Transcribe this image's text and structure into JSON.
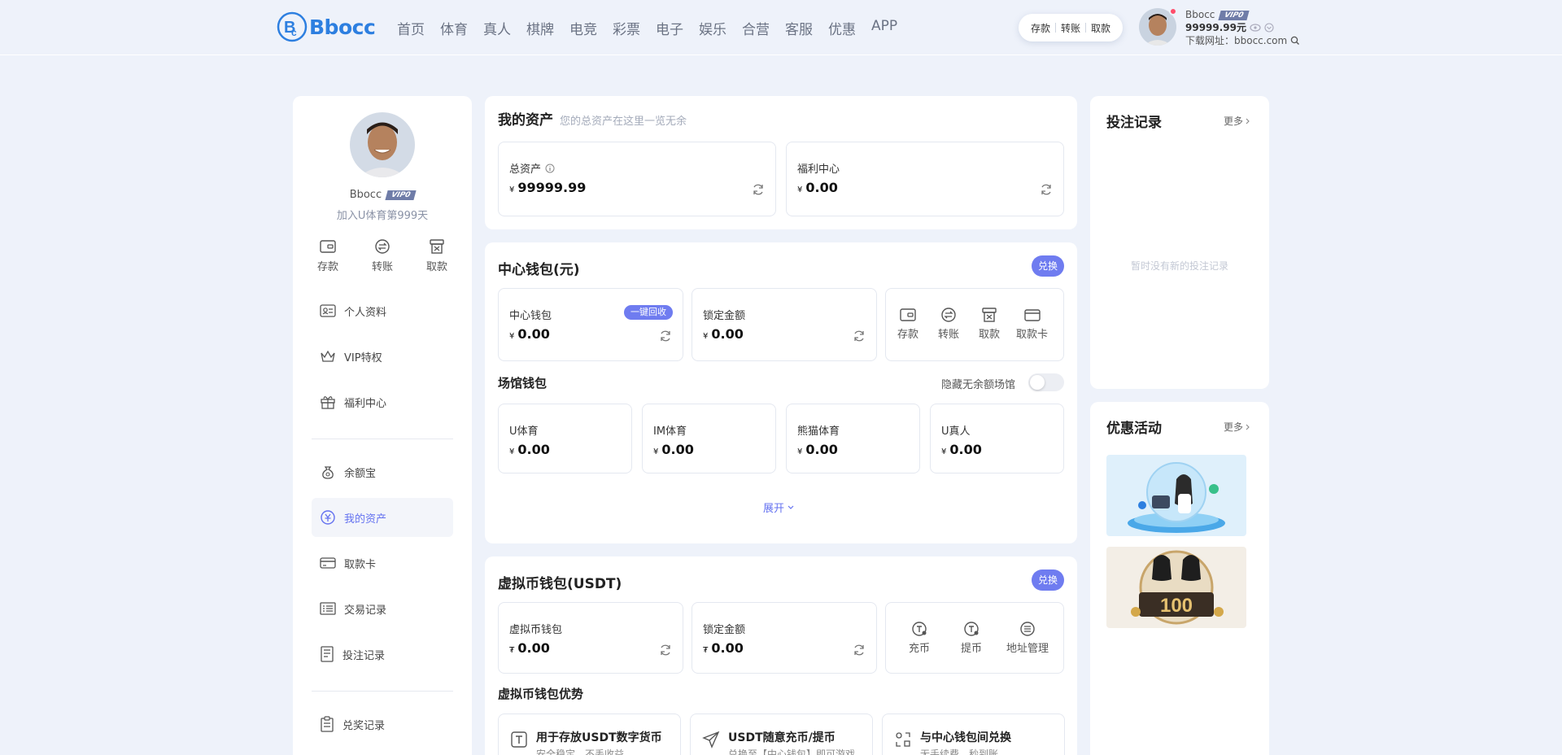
{
  "brand": {
    "name": "Bbocc"
  },
  "nav": [
    "首页",
    "体育",
    "真人",
    "棋牌",
    "电竞",
    "彩票",
    "电子",
    "娱乐",
    "合营",
    "客服",
    "优惠",
    "APP"
  ],
  "header": {
    "quick": {
      "deposit": "存款",
      "transfer": "转账",
      "withdraw": "取款"
    },
    "username": "Bbocc",
    "vip": "VIP0",
    "balance": "99999.99元",
    "download": "下载网址：bbocc.com"
  },
  "profile": {
    "name": "Bbocc",
    "vip": "VIP0",
    "joined": "加入U体育第999天",
    "actions": {
      "deposit": "存款",
      "transfer": "转账",
      "withdraw": "取款"
    }
  },
  "menu": {
    "group1": [
      "个人资料",
      "VIP特权",
      "福利中心"
    ],
    "group2": [
      "余额宝",
      "我的资产",
      "取款卡",
      "交易记录",
      "投注记录"
    ],
    "group3": [
      "兑奖记录"
    ],
    "active": "我的资产"
  },
  "assets": {
    "title": "我的资产",
    "subtitle": "您的总资产在这里一览无余",
    "total_label": "总资产",
    "total_currency": "¥",
    "total_value": "99999.99",
    "welfare_label": "福利中心",
    "welfare_currency": "¥",
    "welfare_value": "0.00"
  },
  "center_wallet": {
    "title": "中心钱包(元)",
    "exchange": "兑换",
    "wallet_label": "中心钱包",
    "recall": "一键回收",
    "wallet_currency": "¥",
    "wallet_value": "0.00",
    "locked_label": "锁定金额",
    "locked_currency": "¥",
    "locked_value": "0.00",
    "actions": {
      "deposit": "存款",
      "transfer": "转账",
      "withdraw": "取款",
      "card": "取款卡"
    }
  },
  "venue_wallet": {
    "title": "场馆钱包",
    "hide_label": "隐藏无余额场馆",
    "hide_on": false,
    "venues": [
      {
        "name": "U体育",
        "currency": "¥",
        "value": "0.00"
      },
      {
        "name": "IM体育",
        "currency": "¥",
        "value": "0.00"
      },
      {
        "name": "熊猫体育",
        "currency": "¥",
        "value": "0.00"
      },
      {
        "name": "U真人",
        "currency": "¥",
        "value": "0.00"
      }
    ],
    "expand": "展开"
  },
  "crypto_wallet": {
    "title": "虚拟币钱包(USDT)",
    "exchange": "兑换",
    "wallet_label": "虚拟币钱包",
    "wallet_currency": "₮",
    "wallet_value": "0.00",
    "locked_label": "锁定金额",
    "locked_currency": "₮",
    "locked_value": "0.00",
    "actions": {
      "recharge": "充币",
      "withdraw": "提币",
      "address": "地址管理"
    },
    "advantages_title": "虚拟币钱包优势",
    "advantages": [
      {
        "title": "用于存放USDT数字货币",
        "desc": "安全稳定，不丢收益"
      },
      {
        "title": "USDT随意充币/提币",
        "desc": "兑换至【中心钱包】即可游戏"
      },
      {
        "title": "与中心钱包间兑换",
        "desc": "无手续费，秒到账"
      }
    ]
  },
  "bet_records": {
    "title": "投注记录",
    "more": "更多",
    "empty": "暂时没有新的投注记录"
  },
  "promotions": {
    "title": "优惠活动",
    "more": "更多"
  },
  "colors": {
    "accent": "#6f7cf0",
    "logo": "#2d7fe0",
    "background": "#eef2fa"
  }
}
